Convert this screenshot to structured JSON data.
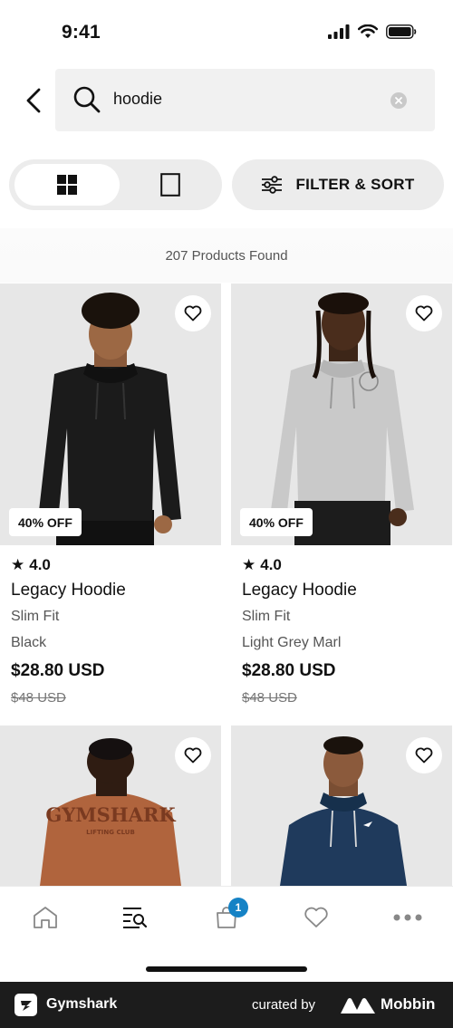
{
  "status_bar": {
    "time": "9:41"
  },
  "search": {
    "query": "hoodie"
  },
  "controls": {
    "filter_label": "FILTER & SORT"
  },
  "results": {
    "count_text": "207 Products Found"
  },
  "products": [
    {
      "rating": "4.0",
      "name": "Legacy Hoodie",
      "fit": "Slim Fit",
      "color": "Black",
      "price": "$28.80 USD",
      "old_price": "$48 USD",
      "discount": "40% OFF",
      "hoodie_color": "#1b1b1b"
    },
    {
      "rating": "4.0",
      "name": "Legacy Hoodie",
      "fit": "Slim Fit",
      "color": "Light Grey Marl",
      "price": "$28.80 USD",
      "old_price": "$48 USD",
      "discount": "40% OFF",
      "hoodie_color": "#c9c9c9"
    },
    {
      "hoodie_color": "#b0643d",
      "back_print": "GYMSHARK",
      "back_print_sub": "LIFTING CLUB"
    },
    {
      "hoodie_color": "#1f3a5c"
    }
  ],
  "tab_bar": {
    "cart_badge": "1"
  },
  "footer": {
    "brand": "Gymshark",
    "curated_by": "curated by",
    "mobbin": "Mobbin"
  }
}
